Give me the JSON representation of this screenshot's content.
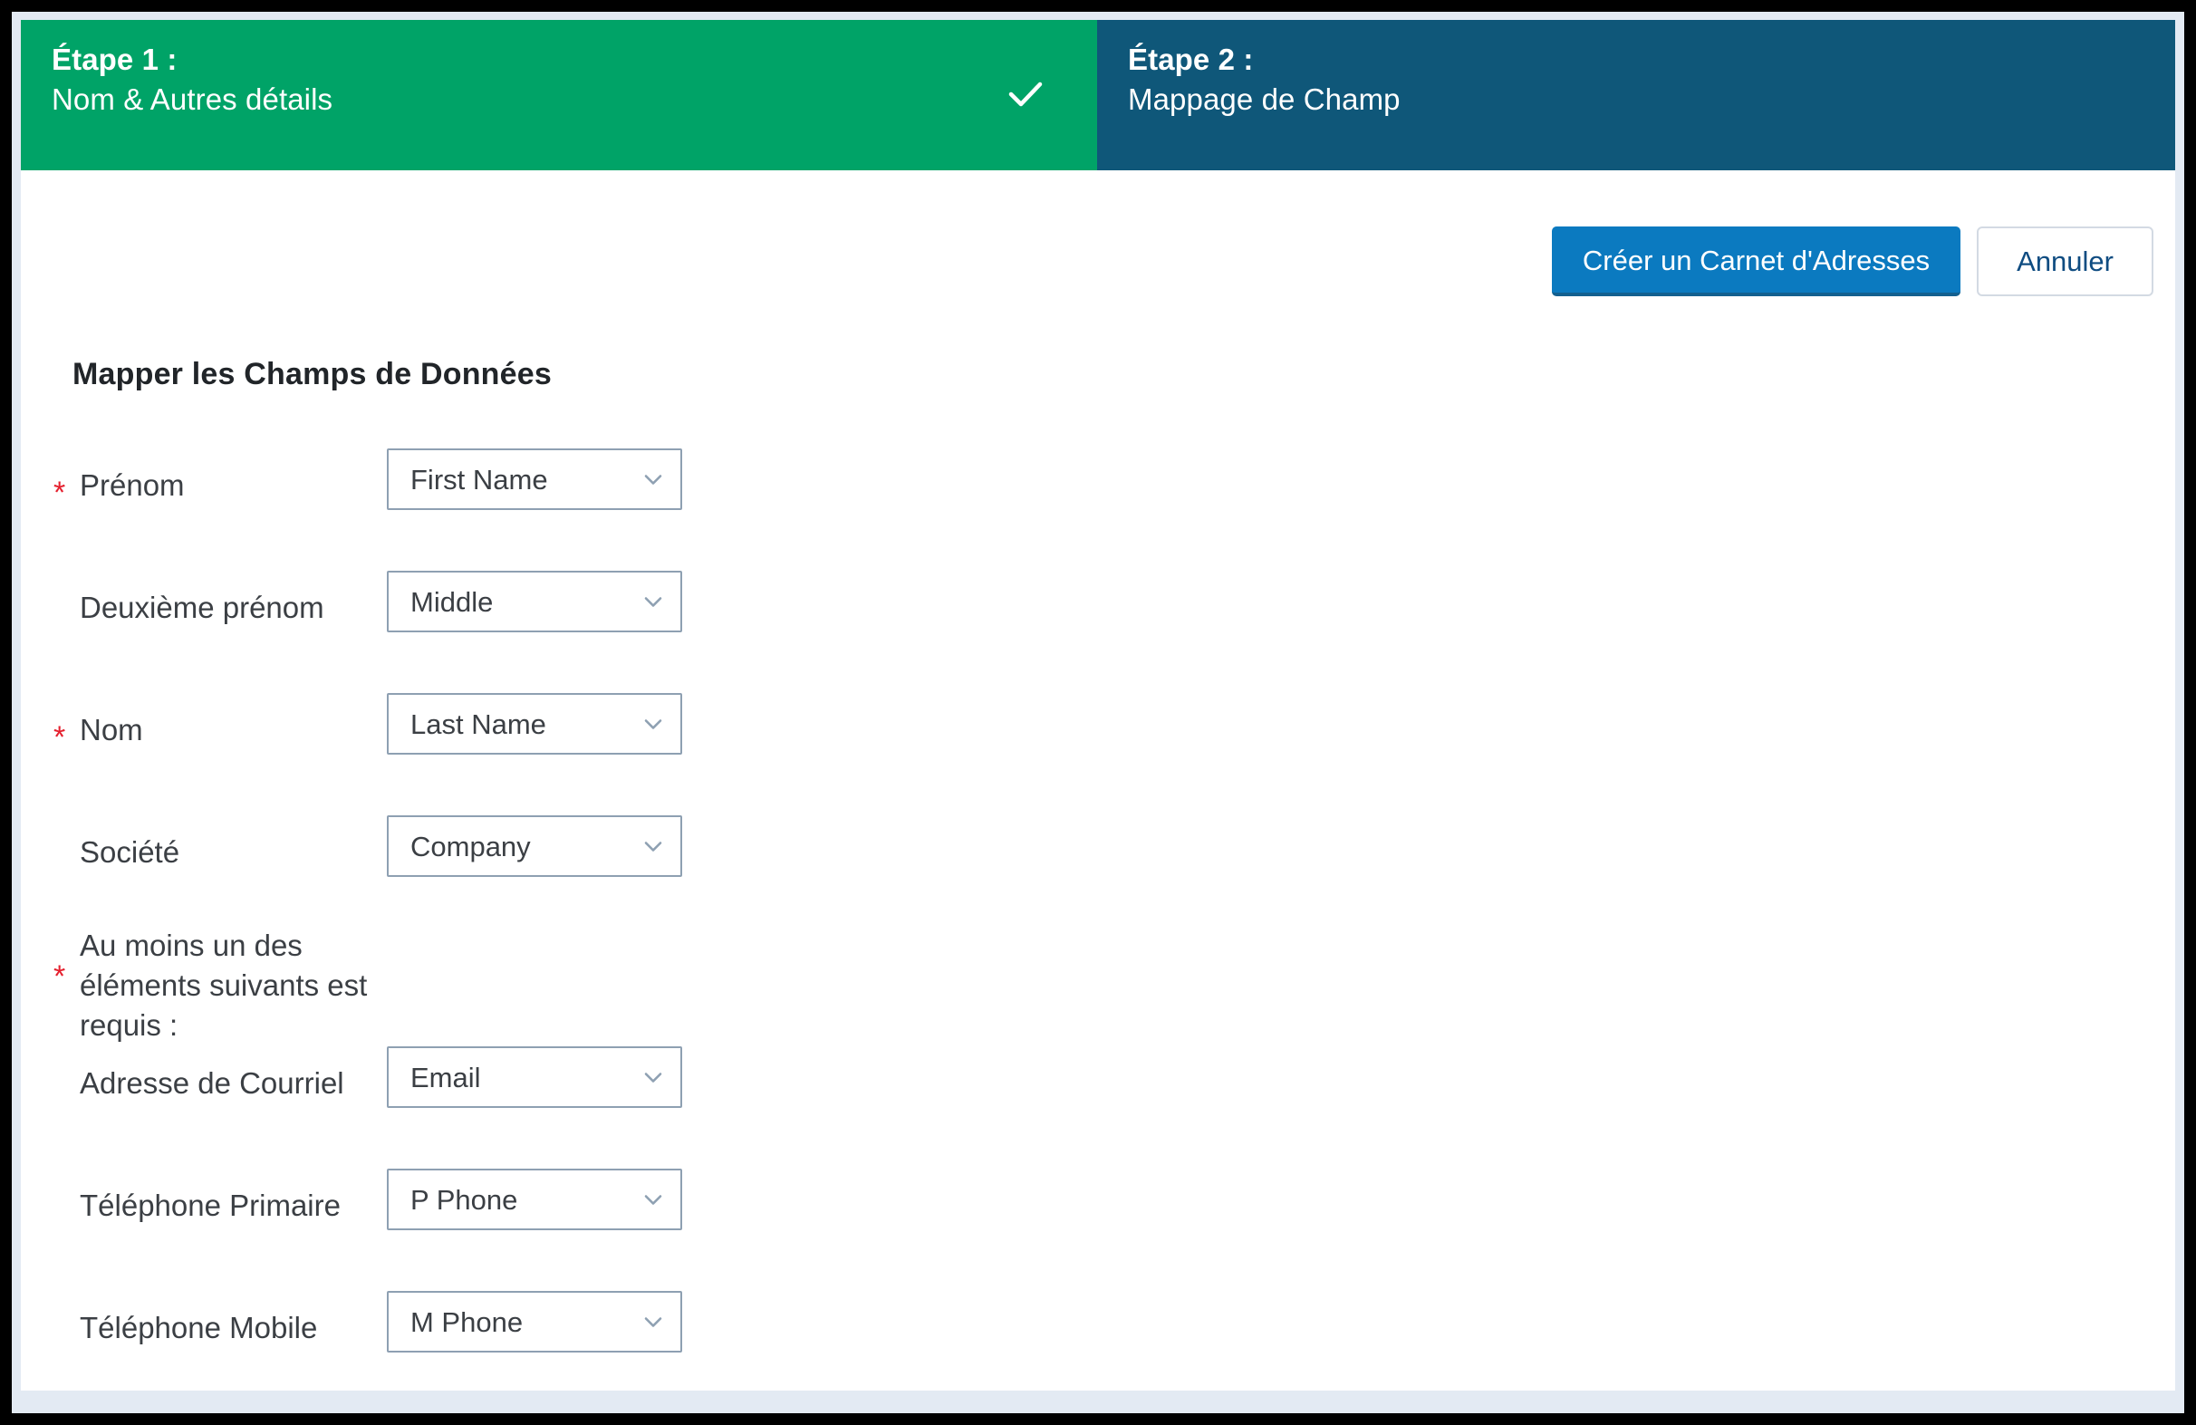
{
  "wizard": {
    "steps": [
      {
        "number": "Étape 1 :",
        "title": "Nom & Autres détails",
        "state": "completed",
        "color": "#00a367",
        "icon": "check-icon"
      },
      {
        "number": "Étape 2 :",
        "title": "Mappage de Champ",
        "state": "active",
        "color": "#0f5779",
        "icon": ""
      }
    ]
  },
  "actions": {
    "primary_label": "Créer un Carnet d'Adresses",
    "primary_color": "#0b7ac0",
    "secondary_label": "Annuler",
    "secondary_text_color": "#0f4c81"
  },
  "form": {
    "heading": "Mapper les Champs de Données",
    "required_marker": "*",
    "required_marker_color": "#e5202e",
    "note": {
      "marker": "*",
      "text": "Au moins un des éléments suivants est requis :"
    },
    "rows": [
      {
        "required": true,
        "label": "Prénom",
        "value": "First Name",
        "icon": "chevron-down-icon"
      },
      {
        "required": false,
        "label": "Deuxième prénom",
        "value": "Middle",
        "icon": "chevron-down-icon"
      },
      {
        "required": true,
        "label": "Nom",
        "value": "Last Name",
        "icon": "chevron-down-icon"
      },
      {
        "required": false,
        "label": "Société",
        "value": "Company",
        "icon": "chevron-down-icon"
      }
    ],
    "rows_after_note": [
      {
        "required": false,
        "label": "Adresse de Courriel",
        "value": "Email",
        "icon": "chevron-down-icon"
      },
      {
        "required": false,
        "label": "Téléphone Primaire",
        "value": "P Phone",
        "icon": "chevron-down-icon"
      },
      {
        "required": false,
        "label": "Téléphone Mobile",
        "value": "M Phone",
        "icon": "chevron-down-icon"
      }
    ]
  }
}
